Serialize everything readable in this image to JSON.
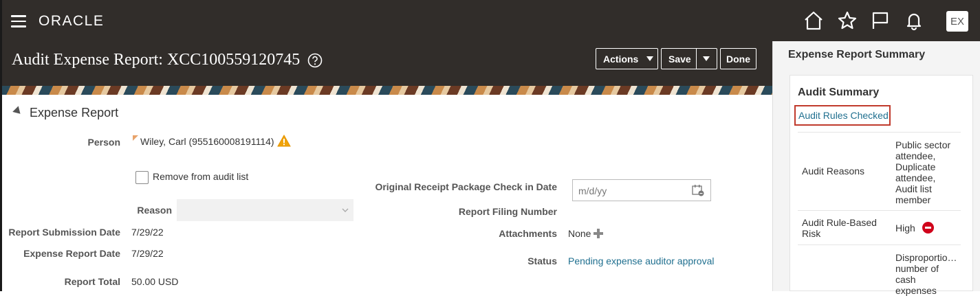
{
  "header": {
    "brand": "ORACLE",
    "user_initials": "EX"
  },
  "page": {
    "title": "Audit Expense Report: XCC100559120745"
  },
  "toolbar": {
    "actions_label": "Actions",
    "save_label": "Save",
    "done_label": "Done"
  },
  "section": {
    "title": "Expense Report"
  },
  "form": {
    "person_label": "Person",
    "person_value": "Wiley, Carl (955160008191114)",
    "remove_label": "Remove from audit list",
    "reason_label": "Reason",
    "submission_label": "Report Submission Date",
    "submission_value": "7/29/22",
    "expense_date_label": "Expense Report Date",
    "expense_date_value": "7/29/22",
    "total_label": "Report Total",
    "total_value": "50.00 USD",
    "receipt_label": "Original Receipt Package Check in Date",
    "receipt_placeholder": "m/d/yy",
    "filing_label": "Report Filing Number",
    "attachments_label": "Attachments",
    "attachments_value": "None",
    "status_label": "Status",
    "status_value": "Pending expense auditor approval"
  },
  "panel": {
    "title": "Expense Report Summary",
    "card_title": "Audit Summary",
    "rules_link": "Audit Rules Checked",
    "reasons_label": "Audit Reasons",
    "reasons_value": [
      "Public sector",
      "attendee,",
      "Duplicate",
      "attendee,",
      "Audit list",
      "member"
    ],
    "risk_label_1": "Audit Rule-Based",
    "risk_label_2": "Risk",
    "risk_value": "High",
    "third_value": [
      "Disproportio…",
      "number of",
      "cash",
      "expenses"
    ]
  },
  "colors": {
    "header_bg": "#312d2a",
    "link": "#1f6f8f",
    "highlight_border": "#c0392b",
    "risk_high": "#d0021b"
  }
}
